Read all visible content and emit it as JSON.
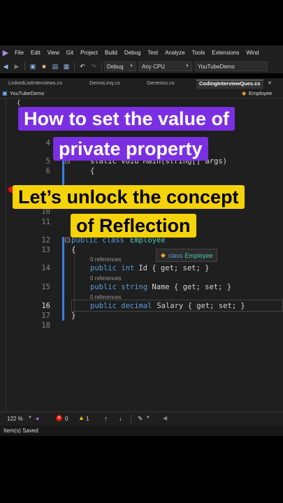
{
  "menu": [
    "File",
    "Edit",
    "View",
    "Git",
    "Project",
    "Build",
    "Debug",
    "Test",
    "Analyze",
    "Tools",
    "Extensions",
    "Wind"
  ],
  "toolbar": {
    "config": "Debug",
    "platform": "Any CPU",
    "startup": "YouTubeDemo"
  },
  "tabs": [
    "LinkedListInterviews.cs",
    "DemoLinq.cs",
    "Generics.cs",
    "CodingInterviewQues.cs"
  ],
  "nav": {
    "project": "YouTubeDemo",
    "member": "Employee"
  },
  "captions": {
    "line1": "How to set the value of",
    "line2": "private property",
    "line3": "Let’s unlock the concept",
    "line4": "of Reflection"
  },
  "code": {
    "ln4": "4",
    "ln5": "5",
    "ln6": "6",
    "ln10": "10",
    "ln11": "11",
    "ln12": "12",
    "ln13": "13",
    "ln14": "14",
    "ln15": "15",
    "ln16": "16",
    "ln17": "17",
    "ln18": "18",
    "main": "static void Main(string[] args)",
    "brace_open": "{",
    "class_kw": "public class",
    "class_name": "Employee",
    "brace_open2": "{",
    "refs1": "0 references",
    "refs2": "0 references",
    "refs3": "0 references",
    "l14_kw": "public int",
    "l14_rest": " Id { get; set; }",
    "l15_kw": "public string",
    "l15_rest": " Name { get; set; }",
    "l16_kw": "public decimal",
    "l16_rest": " Salary { get; set; }",
    "brace_close": "}"
  },
  "tooltip": {
    "kw": "class",
    "name": "Employee"
  },
  "editor_status": {
    "zoom": "122 %",
    "errors": "0",
    "warnings": "1"
  },
  "app_status": "Item(s) Saved"
}
